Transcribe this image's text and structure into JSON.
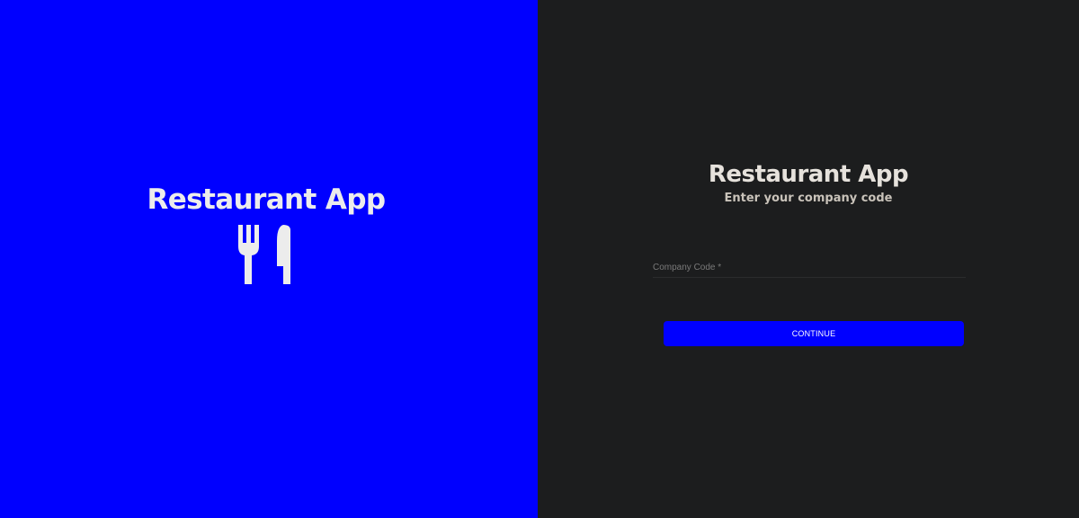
{
  "brand": {
    "title": "Restaurant App",
    "icon": "utensils-icon"
  },
  "login": {
    "title": "Restaurant App",
    "subtitle": "Enter your company code",
    "company_code_label": "Company Code *",
    "company_code_value": "",
    "continue_label": "CONTINUE"
  },
  "colors": {
    "brand_blue": "#0000ff",
    "panel_dark": "#1c1d1e",
    "text_light": "#ececec"
  }
}
